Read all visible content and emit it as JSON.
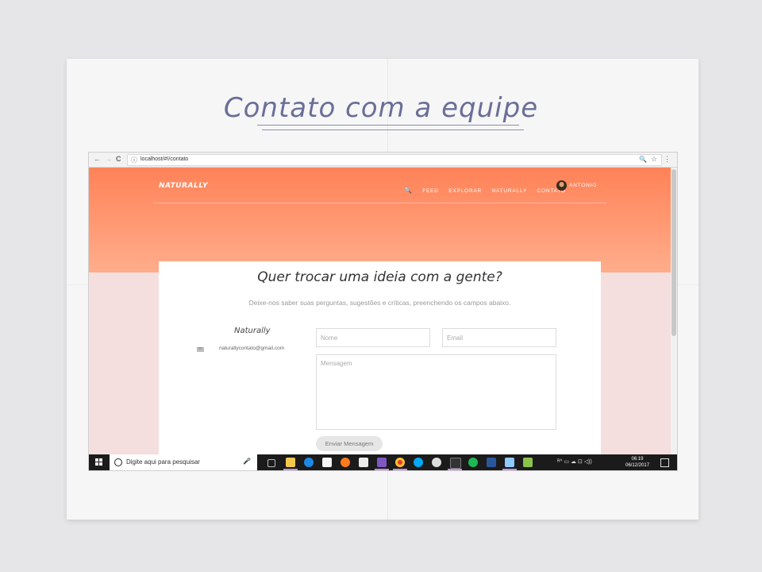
{
  "page": {
    "heading": "Contato com a equipe"
  },
  "browser": {
    "back_glyph": "←",
    "forward_glyph": "→",
    "reload_glyph": "C",
    "info_glyph": "ⓘ",
    "url": "localhost/#!/contato",
    "zoom_glyph": "🔍",
    "star_glyph": "☆",
    "menu_glyph": "⋮"
  },
  "site": {
    "logo": "NATURALLY",
    "nav": {
      "search_glyph": "🔍",
      "items": [
        "FEED",
        "EXPLORAR",
        "NATURALLY",
        "CONTATO"
      ],
      "user": "ANTONIO"
    },
    "contact": {
      "title": "Quer trocar uma ideia com a gente?",
      "subtitle": "Deixe-nos saber suas perguntas, sugestões e críticas, preenchendo os campos abaixo.",
      "brand_name": "Naturally",
      "email": "naturallycontato@gmail.com",
      "form": {
        "name_placeholder": "Nome",
        "email_placeholder": "Email",
        "message_placeholder": "Mensagem",
        "submit_label": "Enviar Mensagem"
      }
    }
  },
  "taskbar": {
    "search_placeholder": "Digite aqui para pesquisar",
    "mic_glyph": "🎤",
    "apps": [
      "task-view",
      "file-explorer",
      "edge",
      "store",
      "firefox",
      "mail",
      "visual-studio",
      "chrome",
      "skype",
      "settings",
      "terminal",
      "spotify",
      "word",
      "notepad",
      "android-studio"
    ],
    "tray_text": "ᴿ^  ▭  ☁  ⊡  ◁))",
    "time": "06:19",
    "date": "06/12/2017"
  },
  "colors": {
    "hero_top": "#ff8257",
    "hero_bottom": "#ffad8c",
    "page_bg": "#f5dede",
    "heading": "#6a6e98"
  }
}
